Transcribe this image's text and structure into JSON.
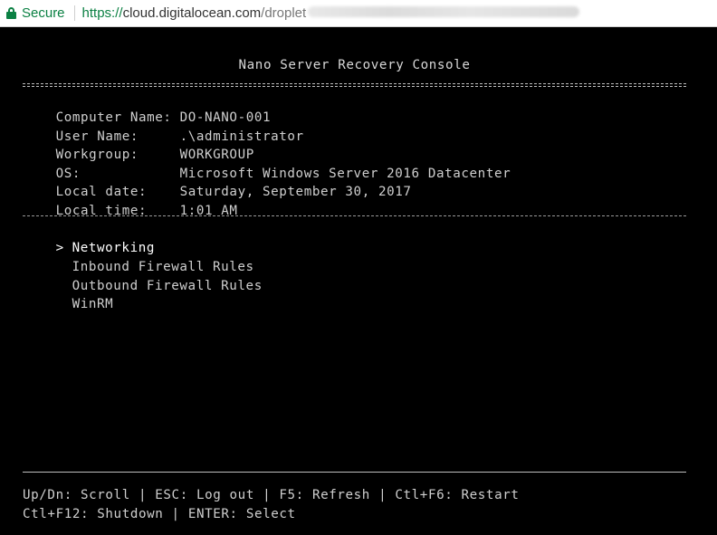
{
  "browser": {
    "secure_label": "Secure",
    "url_scheme": "https://",
    "url_host": "cloud.digitalocean.com",
    "url_path": "/droplet"
  },
  "console": {
    "title": "Nano Server Recovery Console",
    "info": [
      {
        "label": "Computer Name:",
        "value": "DO-NANO-001"
      },
      {
        "label": "User Name:",
        "value": ".\\administrator"
      },
      {
        "label": "Workgroup:",
        "value": "WORKGROUP"
      },
      {
        "label": "OS:",
        "value": "Microsoft Windows Server 2016 Datacenter"
      },
      {
        "label": "Local date:",
        "value": "Saturday, September 30, 2017"
      },
      {
        "label": "Local time:",
        "value": "1:01 AM"
      }
    ],
    "menu": {
      "cursor": ">",
      "items": [
        "Networking",
        "Inbound Firewall Rules",
        "Outbound Firewall Rules",
        "WinRM"
      ]
    },
    "help": {
      "line1": "Up/Dn: Scroll | ESC: Log out | F5: Refresh | Ctl+F6: Restart",
      "line2": "Ctl+F12: Shutdown | ENTER: Select"
    }
  },
  "colors": {
    "secure_green": "#0b8043",
    "console_bg": "#000000",
    "console_text": "#cfcfcf"
  }
}
